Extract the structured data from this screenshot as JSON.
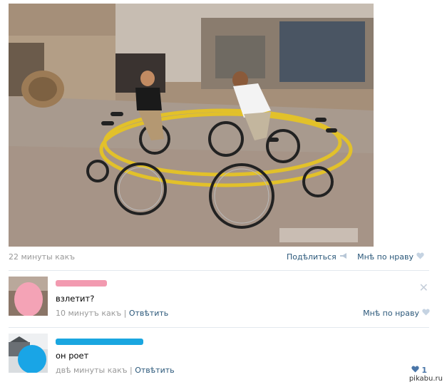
{
  "post": {
    "time": "22 минуты какъ",
    "share_label": "Подѣлиться",
    "like_label": "Мнѣ по нраву"
  },
  "comments": [
    {
      "text": "взлетит?",
      "time": "10 минутъ какъ",
      "separator": "|",
      "reply_label": "Отвѣтить",
      "like_label": "Мнѣ по нраву",
      "author_color": "#f29ab0",
      "avatar_color": "#f4a3b6"
    },
    {
      "text": "он роет",
      "time": "двѣ минуты какъ",
      "separator": "|",
      "reply_label": "Отвѣтить",
      "like_count": "1",
      "author_color": "#1aa6e0",
      "avatar_color": "#19a5e6"
    }
  ],
  "watermark": "pikabu.ru",
  "icons": {
    "share": "megaphone-icon",
    "like": "heart-icon",
    "close": "close-icon"
  }
}
